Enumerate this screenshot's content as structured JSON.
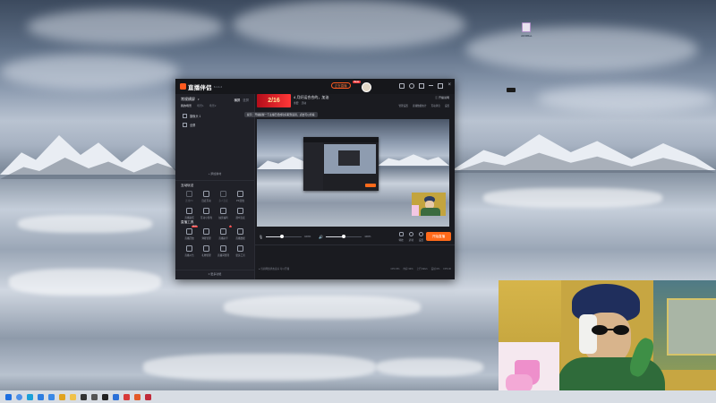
{
  "desktop": {
    "icon1_label": "dzFRBaL",
    "icon2_label": ""
  },
  "app": {
    "name": "直播伴侣",
    "version": "6.1.1.4",
    "status_pill": "正在直播",
    "pill_badge": "Beta",
    "header_icons": [
      "gift-icon",
      "bell-icon",
      "shirt-icon",
      "minimize-icon",
      "maximize-icon",
      "close-icon"
    ],
    "banner": {
      "date_text": "2/16",
      "title": "4 月好运合合的，加油",
      "sub_left": "重要",
      "sub_right": "活动"
    },
    "tooltip": "提示：开播提醒一下主播已经成功获取到运营，点击可以查看",
    "right_top_labels": [
      "管理设置",
      "直播数据统计",
      "互动消息",
      "设置"
    ],
    "right_top_link": "开播说明",
    "scene_tab_active": "常规横屏",
    "scene_tabs": [
      "横屏",
      "竖屏"
    ],
    "scene_subtabs": [
      "我的场景",
      "场景1",
      "场景2"
    ],
    "sources": [
      "摄像头 1",
      "全屏"
    ],
    "add_source": "+ 添加素材",
    "interactive_title": "互动玩法",
    "interactive_tools": [
      {
        "label": "连线PK",
        "dim": true
      },
      {
        "label": "连麦互动",
        "dim": false
      },
      {
        "label": "多人连麦",
        "dim": true
      },
      {
        "label": "PK连线",
        "dim": false
      },
      {
        "label": "直播贴纸",
        "dim": false
      },
      {
        "label": "互动小游戏",
        "dim": false
      },
      {
        "label": "抽奖福利",
        "dim": false
      },
      {
        "label": "观众连麦",
        "dim": false
      }
    ],
    "tools_title": "直播工具",
    "live_tools": [
      {
        "label": "直播回放",
        "badge": "NEW"
      },
      {
        "label": "弹幕管理",
        "badge": ""
      },
      {
        "label": "直播助手",
        "badge": "2"
      },
      {
        "label": "直播数据",
        "badge": ""
      },
      {
        "label": "直播公告",
        "badge": ""
      },
      {
        "label": "礼物管理",
        "badge": ""
      },
      {
        "label": "直播间管理",
        "badge": ""
      },
      {
        "label": "更多工具",
        "badge": ""
      }
    ],
    "more_tools": "更多功能",
    "mic_label": "麦克风",
    "mic_value": "100%",
    "mic_level": 0.45,
    "speaker_label": "扬声器",
    "speaker_value": "100%",
    "speaker_level": 0.5,
    "bottom_icons": [
      {
        "label": "特效"
      },
      {
        "label": "录制"
      },
      {
        "label": "设置"
      }
    ],
    "start_button": "开始直播",
    "status_left": "● 当前网络状态良好 可以开播",
    "status_right": [
      "CPU:6%",
      "内存:33%",
      "上行:0kb/s",
      "丢帧:0%",
      "FPS:30"
    ]
  },
  "taskbar": {
    "icons": [
      "start-icon",
      "search-icon",
      "edge-icon",
      "store-icon",
      "mail-icon",
      "chrome-icon",
      "folder-icon",
      "media-icon",
      "settings-icon",
      "terminal-icon",
      "app1-icon",
      "app2-icon",
      "app3-icon",
      "app4-icon"
    ]
  }
}
